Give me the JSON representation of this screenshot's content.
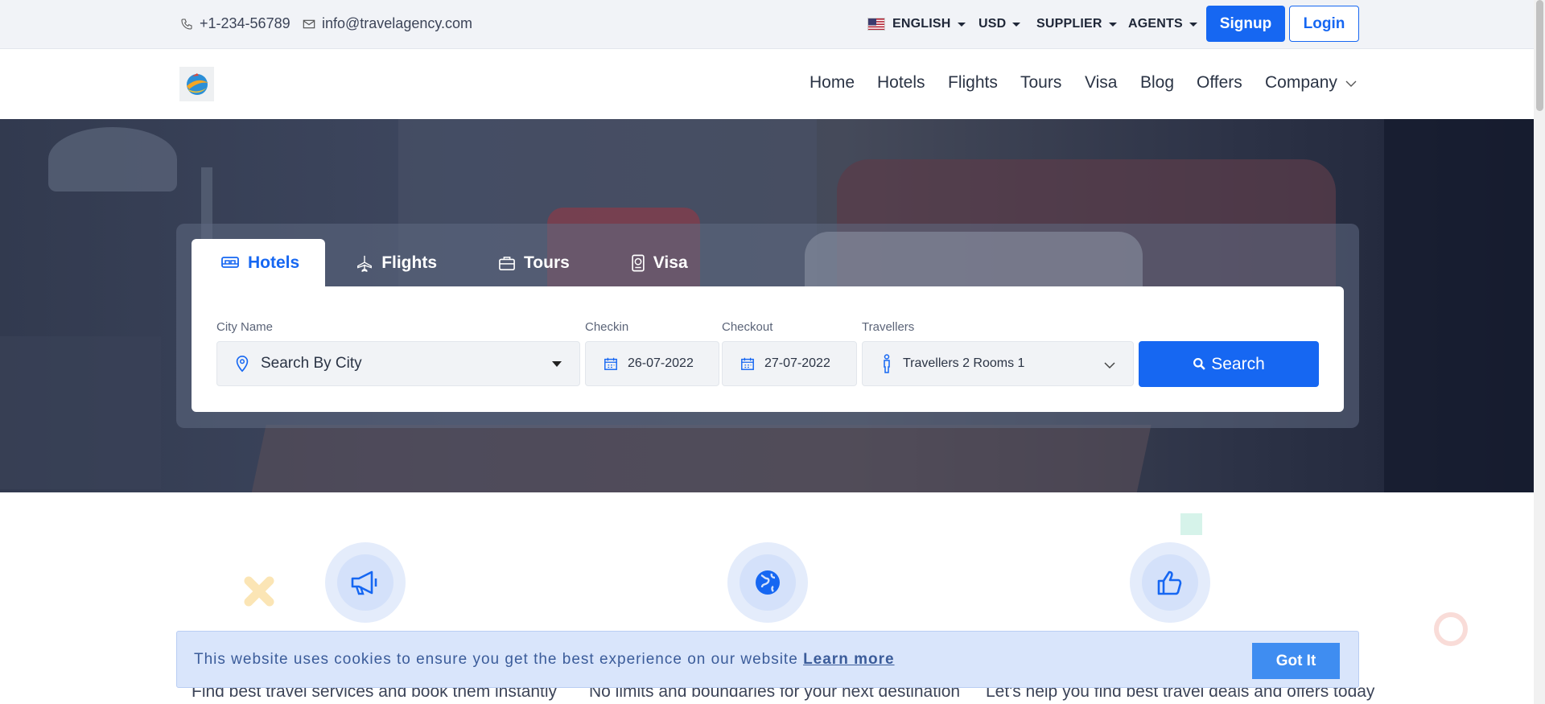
{
  "topbar": {
    "phone": "+1-234-56789",
    "email": "info@travelagency.com",
    "language": "ENGLISH",
    "currency": "USD",
    "supplier": "SUPPLIER",
    "agents": "AGENTS",
    "signup": "Signup",
    "login": "Login"
  },
  "nav": {
    "items": [
      "Home",
      "Hotels",
      "Flights",
      "Tours",
      "Visa",
      "Blog",
      "Offers",
      "Company"
    ]
  },
  "search": {
    "tabs": [
      "Hotels",
      "Flights",
      "Tours",
      "Visa"
    ],
    "active_tab": "Hotels",
    "city_label": "City Name",
    "city_placeholder": "Search By City",
    "checkin_label": "Checkin",
    "checkin_value": "26-07-2022",
    "checkout_label": "Checkout",
    "checkout_value": "27-07-2022",
    "travellers_label": "Travellers",
    "travellers_value": "Travellers 2 Rooms 1",
    "search_button": "Search"
  },
  "features": [
    {
      "icon": "megaphone-icon",
      "text": "Find best travel services and book them instantly"
    },
    {
      "icon": "globe-icon",
      "text": "No limits and boundaries for your next destination"
    },
    {
      "icon": "thumbs-up-icon",
      "text": "Let's help you find best travel deals and offers today"
    }
  ],
  "cookie": {
    "message": "This website uses cookies to ensure you get the best experience on our website",
    "link": "Learn more",
    "button": "Got It"
  },
  "colors": {
    "primary": "#1667f2",
    "topbar_bg": "#f1f3f7",
    "cookie_bg": "#d9e5fb"
  }
}
